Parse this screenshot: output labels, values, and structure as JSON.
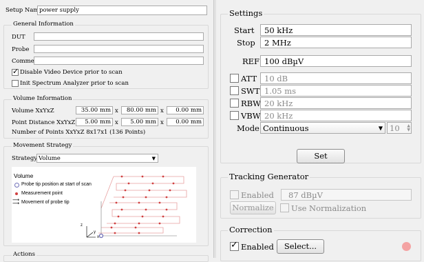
{
  "left": {
    "setup_name_label": "Setup Name",
    "setup_name_value": "power supply",
    "general": {
      "title": "General Information",
      "dut_label": "DUT",
      "probe_label": "Probe",
      "comment_label": "Comment",
      "disable_video_label": "Disable Video Device prior to scan",
      "disable_video_checked": true,
      "init_spectrum_label": "Init Spectrum Analyzer prior to scan",
      "init_spectrum_checked": false
    },
    "volume": {
      "title": "Volume Information",
      "xyz_label": "Volume XxYxZ",
      "xyz_values": [
        "35.00 mm",
        "80.00 mm",
        "0.00 mm"
      ],
      "dist_label": "Point Distance XxYxZ",
      "dist_values": [
        "5.00 mm",
        "5.00 mm",
        "0.00 mm"
      ],
      "sep": "x",
      "points_text": "Number of Points XxYxZ 8x17x1 (136 Points)"
    },
    "movement": {
      "title": "Movement Strategy",
      "strategy_label": "Strategy",
      "strategy_value": "Volume",
      "diagram": {
        "title": "Volume",
        "legend": [
          "Probe tip position at start of scan",
          "Measurement point",
          "Movement of probe tip"
        ],
        "axis_z": "z",
        "axis_y": "y",
        "axis_x": "x"
      }
    },
    "actions_title": "Actions"
  },
  "settings": {
    "title": "Settings",
    "start_label": "Start",
    "start_value": "50 kHz",
    "stop_label": "Stop",
    "stop_value": "2 MHz",
    "ref_label": "REF",
    "ref_value": "100 dBµV",
    "att_label": "ATT",
    "att_value": "10 dB",
    "swt_label": "SWT",
    "swt_value": "1.05 ms",
    "rbw_label": "RBW",
    "rbw_value": "20 kHz",
    "vbw_label": "VBW",
    "vbw_value": "20 kHz",
    "mode_label": "Mode",
    "mode_value": "Continuous",
    "spin_value": "10",
    "set_label": "Set"
  },
  "tracking": {
    "title": "Tracking Generator",
    "enabled_label": "Enabled",
    "level_value": "87 dBµV",
    "normalize_label": "Normalize",
    "use_norm_label": "Use Normalization"
  },
  "correction": {
    "title": "Correction",
    "enabled_label": "Enabled",
    "enabled_checked": true,
    "select_label": "Select...",
    "indicator_color": "#f4a3a3"
  }
}
